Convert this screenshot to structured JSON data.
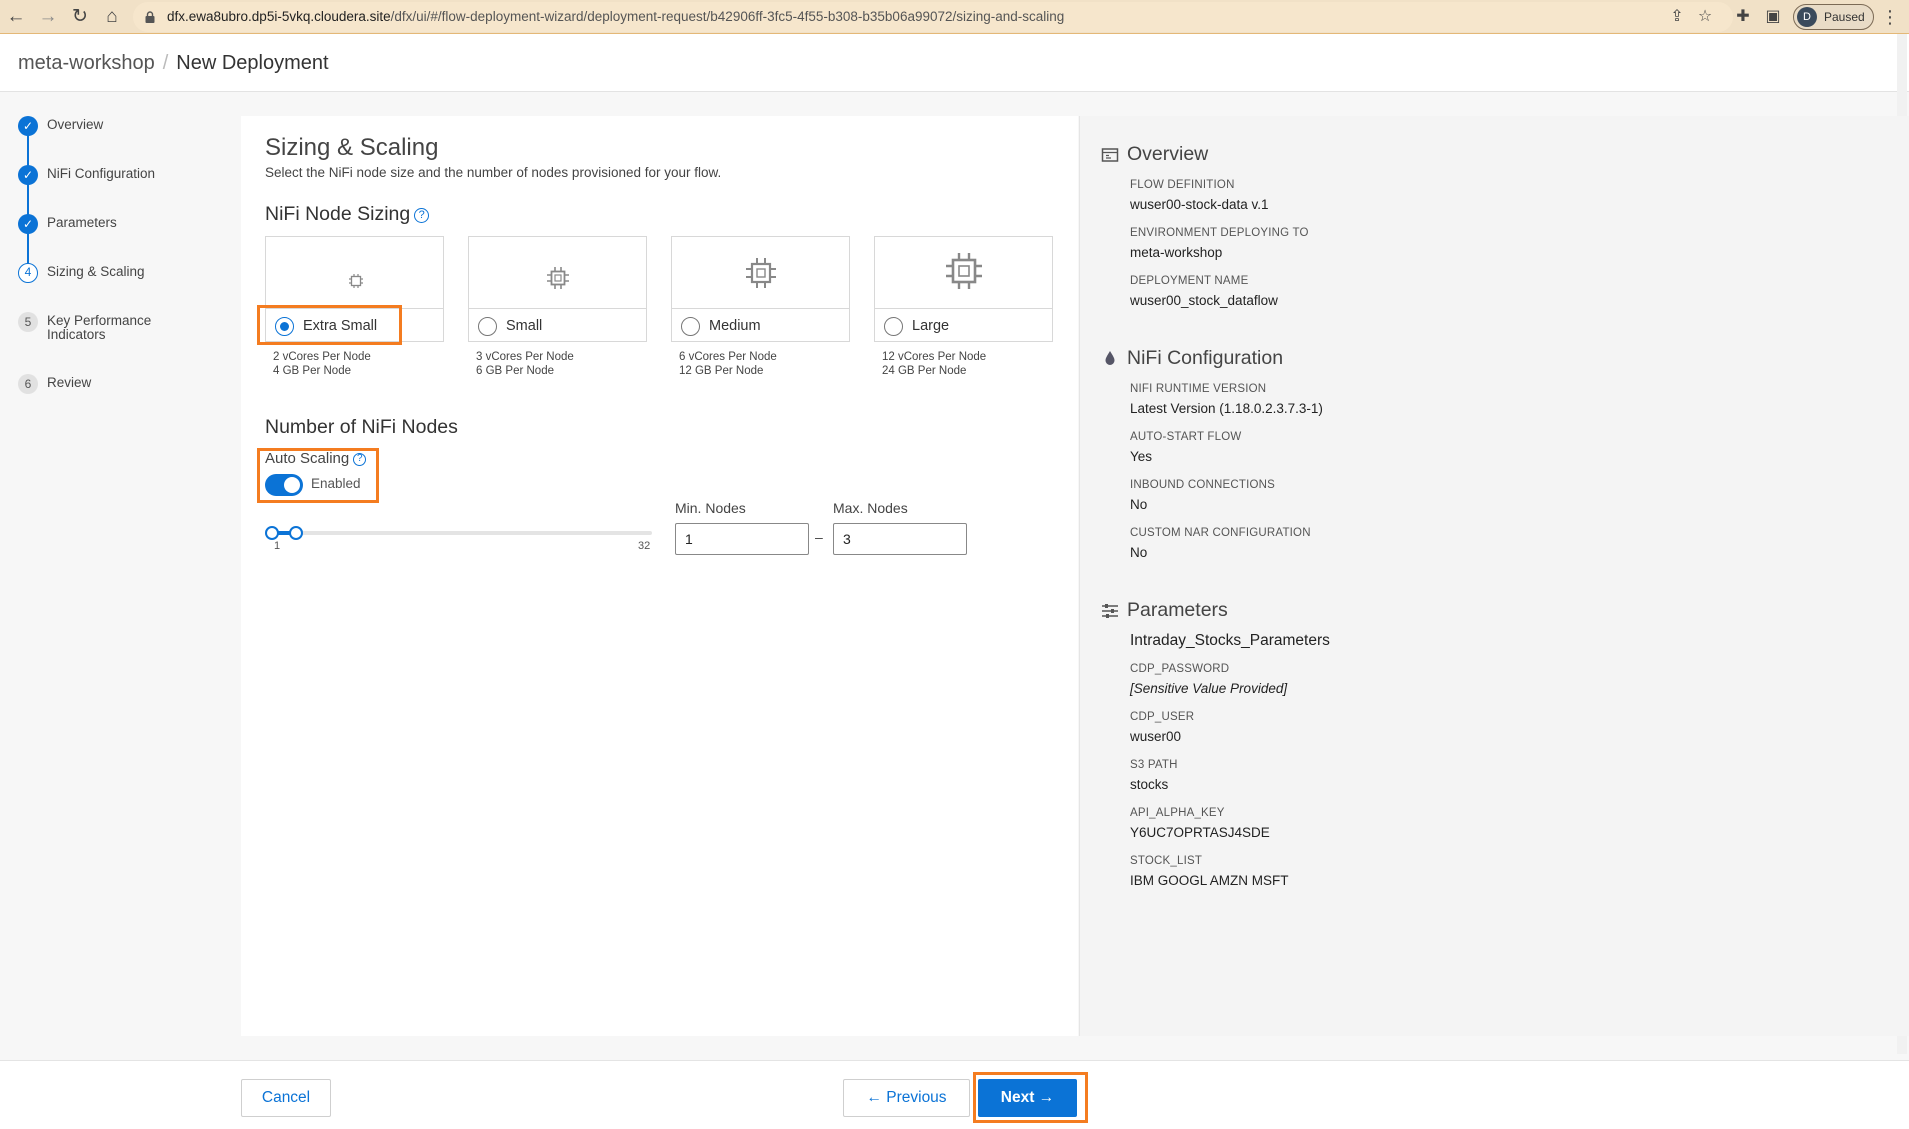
{
  "browser": {
    "url_host": "dfx.ewa8ubro.dp5i-5vkq.cloudera.site",
    "url_path": "/dfx/ui/#/flow-deployment-wizard/deployment-request/b42906ff-3fc5-4f55-b308-b35b06a99072/sizing-and-scaling",
    "profile_initial": "D",
    "profile_status": "Paused"
  },
  "header": {
    "environment": "meta-workshop",
    "separator": "/",
    "page_title": "New Deployment"
  },
  "steps": [
    {
      "number": "✓",
      "label": "Overview",
      "state": "done"
    },
    {
      "number": "✓",
      "label": "NiFi Configuration",
      "state": "done"
    },
    {
      "number": "✓",
      "label": "Parameters",
      "state": "done"
    },
    {
      "number": "4",
      "label": "Sizing & Scaling",
      "state": "current"
    },
    {
      "number": "5",
      "label": "Key Performance Indicators",
      "state": "pending"
    },
    {
      "number": "6",
      "label": "Review",
      "state": "pending"
    }
  ],
  "main": {
    "title": "Sizing & Scaling",
    "subtitle": "Select the NiFi node size and the number of nodes provisioned for your flow.",
    "node_sizing_title": "NiFi Node Sizing",
    "help_glyph": "?",
    "sizes": [
      {
        "label": "Extra Small",
        "cores": "2 vCores Per Node",
        "memory": "4 GB Per Node",
        "selected": true
      },
      {
        "label": "Small",
        "cores": "3 vCores Per Node",
        "memory": "6 GB Per Node",
        "selected": false
      },
      {
        "label": "Medium",
        "cores": "6 vCores Per Node",
        "memory": "12 GB Per Node",
        "selected": false
      },
      {
        "label": "Large",
        "cores": "12 vCores Per Node",
        "memory": "24 GB Per Node",
        "selected": false
      }
    ],
    "nodes_title": "Number of NiFi Nodes",
    "auto_scaling_label": "Auto Scaling",
    "auto_scaling_state": "Enabled",
    "slider_min_tick": "1",
    "slider_max_tick": "32",
    "min_nodes_label": "Min. Nodes",
    "max_nodes_label": "Max. Nodes",
    "min_nodes_value": "1",
    "max_nodes_value": "3",
    "range_dash": "–"
  },
  "summary": {
    "overview": {
      "title": "Overview",
      "fields": [
        {
          "key": "FLOW DEFINITION",
          "value": "wuser00-stock-data v.1"
        },
        {
          "key": "ENVIRONMENT DEPLOYING TO",
          "value": "meta-workshop"
        },
        {
          "key": "DEPLOYMENT NAME",
          "value": "wuser00_stock_dataflow"
        }
      ]
    },
    "nifi_configuration": {
      "title": "NiFi Configuration",
      "fields": [
        {
          "key": "NIFI RUNTIME VERSION",
          "value": "Latest Version (1.18.0.2.3.7.3-1)"
        },
        {
          "key": "AUTO-START FLOW",
          "value": "Yes"
        },
        {
          "key": "INBOUND CONNECTIONS",
          "value": "No"
        },
        {
          "key": "CUSTOM NAR CONFIGURATION",
          "value": "No"
        }
      ]
    },
    "parameters": {
      "title": "Parameters",
      "group_name": "Intraday_Stocks_Parameters",
      "fields": [
        {
          "key": "CDP_PASSWORD",
          "value": "[Sensitive Value Provided]"
        },
        {
          "key": "CDP_USER",
          "value": "wuser00"
        },
        {
          "key": "S3 PATH",
          "value": "stocks"
        },
        {
          "key": "API_ALPHA_KEY",
          "value": "Y6UC7OPRTASJ4SDE"
        },
        {
          "key": "STOCK_LIST",
          "value": "IBM GOOGL AMZN MSFT"
        }
      ]
    }
  },
  "footer": {
    "cancel_label": "Cancel",
    "previous_label": "Previous",
    "next_label": "Next"
  },
  "colors": {
    "accent": "#0b73d6",
    "highlight": "#f47c20"
  }
}
